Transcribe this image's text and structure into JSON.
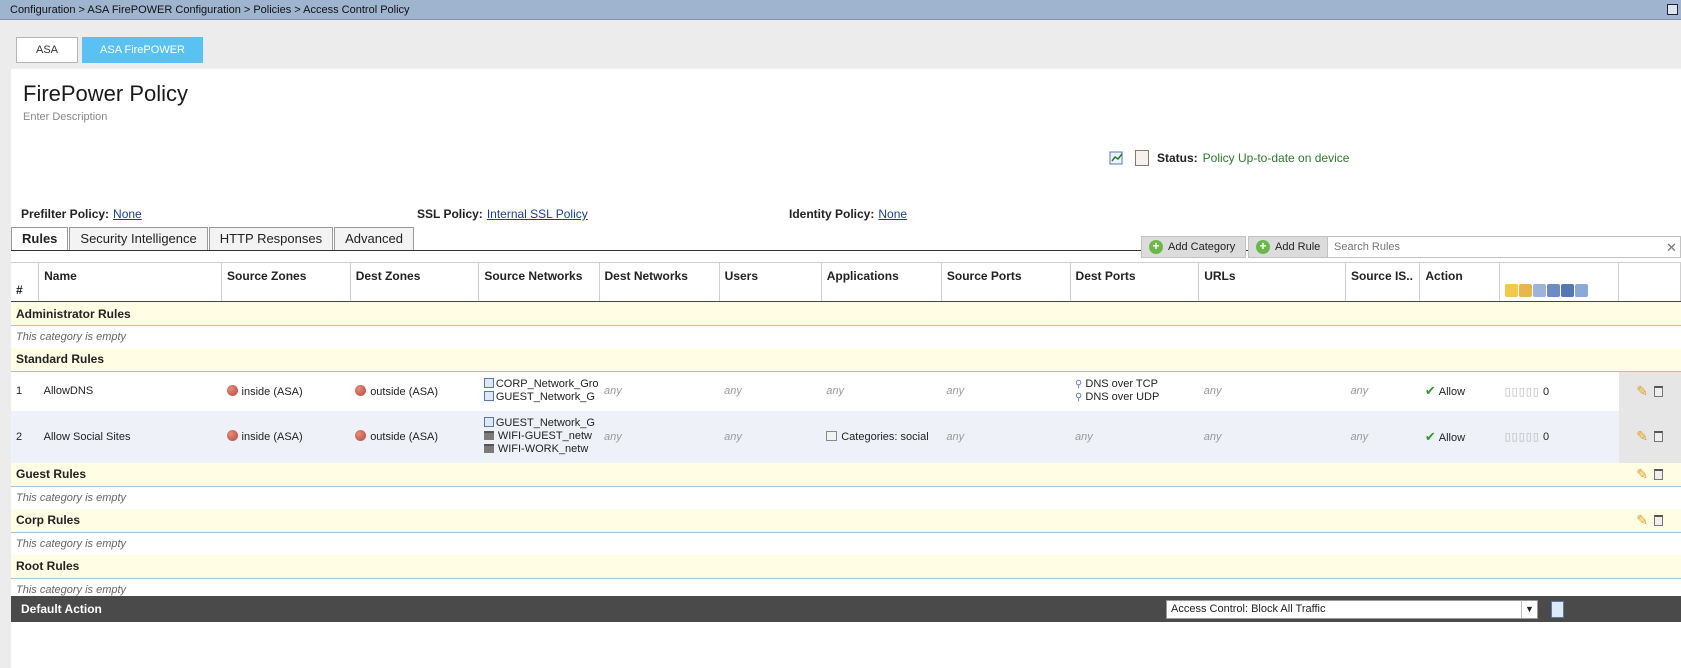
{
  "breadcrumb": "Configuration > ASA FirePOWER Configuration > Policies > Access Control Policy",
  "device_tabs": {
    "asa": "ASA",
    "firepower": "ASA FirePOWER"
  },
  "policy": {
    "title": "FirePower Policy",
    "description": "Enter Description"
  },
  "status": {
    "label": "Status:",
    "value": "Policy Up-to-date on device"
  },
  "links": {
    "prefilter_label": "Prefilter Policy:",
    "prefilter_value": "None",
    "ssl_label": "SSL Policy:",
    "ssl_value": "Internal SSL Policy",
    "identity_label": "Identity Policy:",
    "identity_value": "None"
  },
  "tabs": [
    "Rules",
    "Security Intelligence",
    "HTTP Responses",
    "Advanced"
  ],
  "toolbar": {
    "add_category": "Add Category",
    "add_rule": "Add Rule",
    "search_placeholder": "Search Rules"
  },
  "columns": [
    "#",
    "Name",
    "Source Zones",
    "Dest Zones",
    "Source Networks",
    "Dest Networks",
    "Users",
    "Applications",
    "Source Ports",
    "Dest Ports",
    "URLs",
    "Source IS..",
    "Action"
  ],
  "categories": {
    "administrator": "Administrator Rules",
    "standard": "Standard Rules",
    "guest": "Guest Rules",
    "corp": "Corp Rules",
    "root": "Root Rules",
    "empty_text": "This category is empty"
  },
  "rules": [
    {
      "num": "1",
      "name": "AllowDNS",
      "source_zone": "inside (ASA)",
      "dest_zone": "outside (ASA)",
      "source_networks": [
        "CORP_Network_Gro",
        "GUEST_Network_G"
      ],
      "dest_networks": "any",
      "users": "any",
      "applications": "any",
      "source_ports": "any",
      "dest_ports": [
        "DNS over TCP",
        "DNS over UDP"
      ],
      "urls": "any",
      "source_isp": "any",
      "action": "Allow",
      "count": "0"
    },
    {
      "num": "2",
      "name": "Allow Social Sites",
      "source_zone": "inside (ASA)",
      "dest_zone": "outside (ASA)",
      "source_networks": [
        "GUEST_Network_G",
        "WIFI-GUEST_netw",
        "WIFI-WORK_netw"
      ],
      "dest_networks": "any",
      "users": "any",
      "applications": "Categories: social",
      "source_ports": "any",
      "dest_ports": "any",
      "urls": "any",
      "source_isp": "any",
      "action": "Allow",
      "count": "0"
    }
  ],
  "default_action": {
    "label": "Default Action",
    "value": "Access Control: Block All Traffic"
  },
  "colors": {
    "accent": "#5ac2f2",
    "category_bg": "#fffde3",
    "status_green": "#2c7a2c",
    "default_bar": "#4a4a4a"
  }
}
